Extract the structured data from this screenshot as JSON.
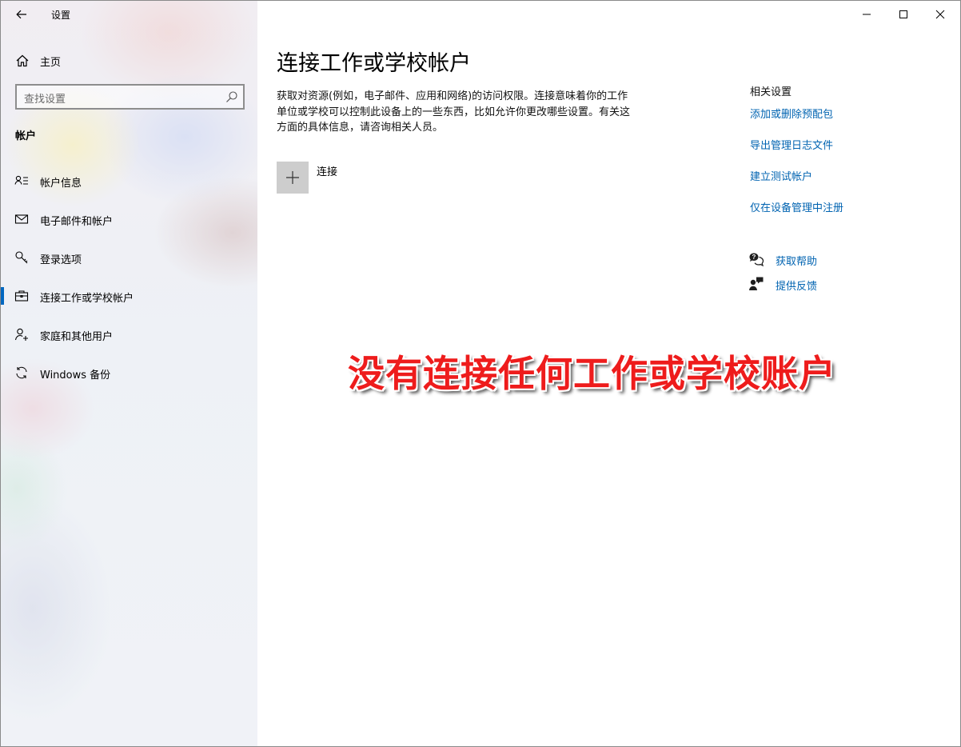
{
  "window": {
    "app_title": "设置",
    "back_icon": "back-arrow-icon",
    "caption_buttons": [
      "minimize-icon",
      "maximize-icon",
      "close-icon"
    ]
  },
  "sidebar": {
    "home_label": "主页",
    "search_placeholder": "查找设置",
    "section_title": "帐户",
    "items": [
      {
        "label": "帐户信息",
        "icon": "account-info-icon",
        "selected": false
      },
      {
        "label": "电子邮件和帐户",
        "icon": "mail-icon",
        "selected": false
      },
      {
        "label": "登录选项",
        "icon": "key-icon",
        "selected": false
      },
      {
        "label": "连接工作或学校帐户",
        "icon": "briefcase-icon",
        "selected": true
      },
      {
        "label": "家庭和其他用户",
        "icon": "add-user-icon",
        "selected": false
      },
      {
        "label": "Windows 备份",
        "icon": "sync-icon",
        "selected": false
      }
    ]
  },
  "main": {
    "title": "连接工作或学校帐户",
    "description": "获取对资源(例如，电子邮件、应用和网络)的访问权限。连接意味着你的工作单位或学校可以控制此设备上的一些东西，比如允许你更改哪些设置。有关这方面的具体信息，请咨询相关人员。",
    "connect_label": "连接",
    "related": {
      "title": "相关设置",
      "links": [
        "添加或删除预配包",
        "导出管理日志文件",
        "建立测试帐户",
        "仅在设备管理中注册"
      ]
    },
    "help": {
      "get_help": "获取帮助",
      "feedback": "提供反馈"
    },
    "overlay_text": "没有连接任何工作或学校账户"
  },
  "colors": {
    "accent": "#0067c0",
    "link": "#0063b1",
    "overlay": "#ee1c1c"
  }
}
